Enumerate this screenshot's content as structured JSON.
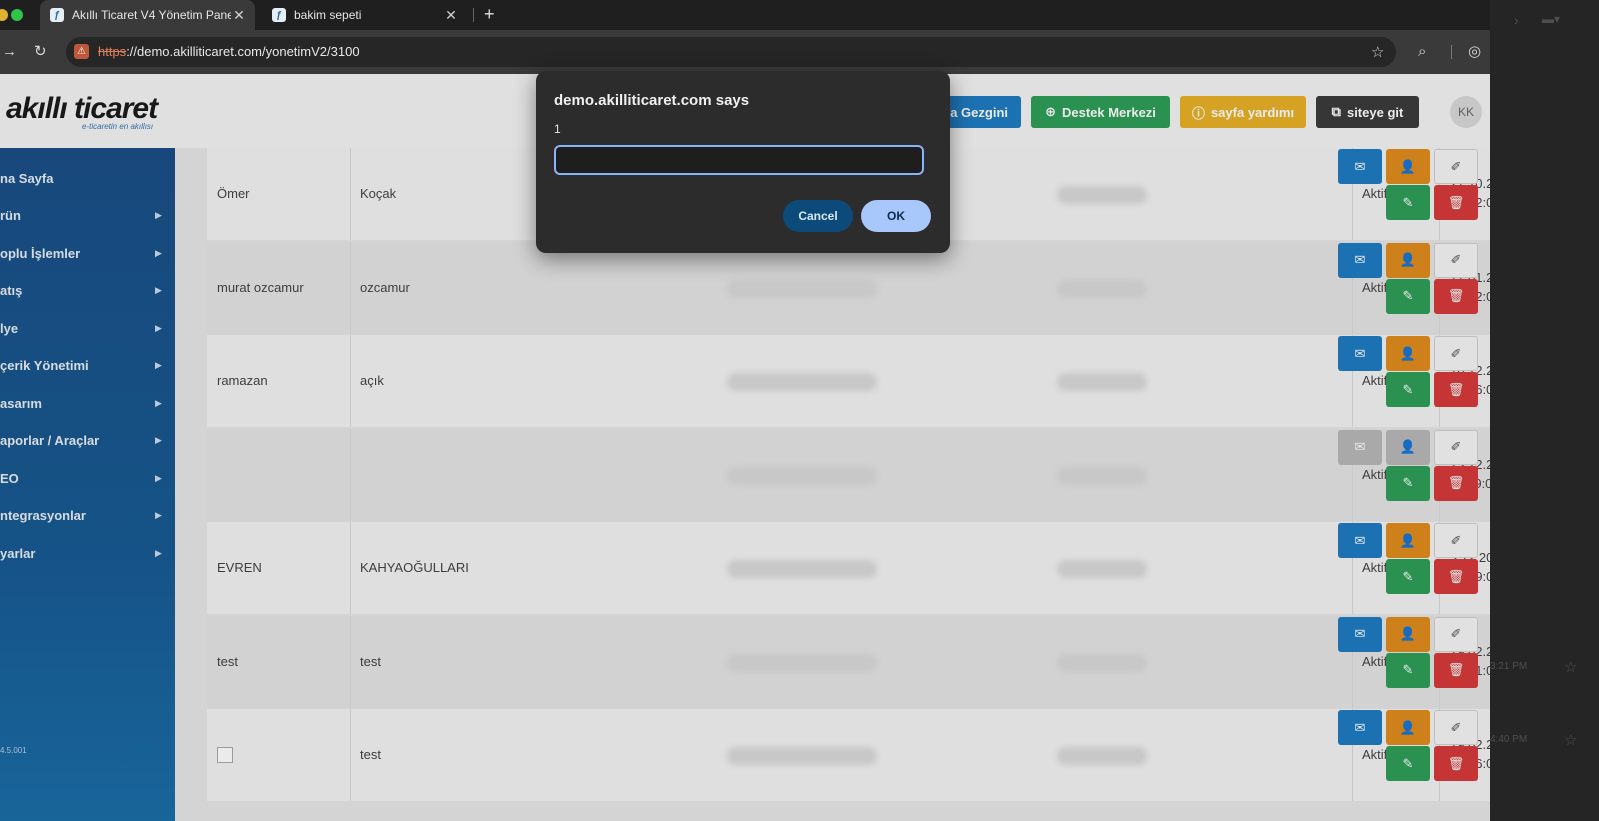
{
  "browser": {
    "tabs": [
      {
        "title": "Akıllı Ticaret V4 Yönetim Pane",
        "active": true
      },
      {
        "title": "bakim sepeti",
        "active": false
      }
    ],
    "new_tab": "+",
    "url_scheme": "https",
    "url_rest": "://demo.akilliticaret.com/yonetimV2/3100"
  },
  "header": {
    "logo_main": "akıllı ticaret",
    "logo_sub": "e-ticaretin en akıllısı",
    "buttons": {
      "site_explorer": "ya Gezgini",
      "support": "Destek Merkezi",
      "help": "sayfa yardımı",
      "visit_site": "siteye git"
    },
    "avatar": "KK"
  },
  "sidebar": {
    "items": [
      {
        "label": "na Sayfa",
        "arrow": false
      },
      {
        "label": "rün",
        "arrow": true
      },
      {
        "label": "oplu İşlemler",
        "arrow": true
      },
      {
        "label": "atış",
        "arrow": true
      },
      {
        "label": "lye",
        "arrow": true
      },
      {
        "label": "çerik Yönetimi",
        "arrow": true
      },
      {
        "label": "asarım",
        "arrow": true
      },
      {
        "label": "aporlar / Araçlar",
        "arrow": true
      },
      {
        "label": "EO",
        "arrow": true
      },
      {
        "label": "ntegrasyonlar",
        "arrow": true
      },
      {
        "label": "yarlar",
        "arrow": true
      }
    ],
    "version": "4.5.001"
  },
  "table": {
    "rows": [
      {
        "first": "Ömer",
        "last": "Koçak",
        "status": "Aktif",
        "date": "27.10.2021",
        "time": "15:02:00",
        "disabled": false,
        "broken_image": false
      },
      {
        "first": "murat ozcamur",
        "last": "ozcamur",
        "status": "Aktif",
        "date": "17.01.2020",
        "time": "00:32:00",
        "disabled": false,
        "broken_image": false
      },
      {
        "first": "ramazan",
        "last": "açık",
        "status": "Aktif",
        "date": "16.12.2019",
        "time": "09:36:00",
        "disabled": false,
        "broken_image": false
      },
      {
        "first": "",
        "last": "",
        "status": "Aktif",
        "date": "13.12.2019",
        "time": "11:49:00",
        "disabled": true,
        "broken_image": false
      },
      {
        "first": "EVREN",
        "last": "KAHYAOĞULLARI",
        "status": "Aktif",
        "date": "3.12.2019",
        "time": "13:59:00",
        "disabled": false,
        "broken_image": false
      },
      {
        "first": "test",
        "last": "test",
        "status": "Aktif",
        "date": "19.02.2019",
        "time": "13:41:00",
        "disabled": false,
        "broken_image": false
      },
      {
        "first": "",
        "last": "test",
        "status": "Aktif",
        "date": "19.02.2019",
        "time": "13:36:00",
        "disabled": false,
        "broken_image": true
      }
    ]
  },
  "dialog": {
    "title": "demo.akilliticaret.com says",
    "message": "1",
    "input_value": "",
    "cancel_label": "Cancel",
    "ok_label": "OK"
  },
  "right_strip": {
    "time1": "3:21 PM",
    "time2": "4:40 PM"
  },
  "colors": {
    "sidebar_blue": "#1b4f86",
    "mail_button": "#1f7bc2",
    "user_button": "#e08d1e",
    "edit_button": "#2f9e57",
    "delete_button": "#d63a3a",
    "dialog_ok": "#a8c7fa",
    "dialog_cancel": "#0c4a7a"
  }
}
